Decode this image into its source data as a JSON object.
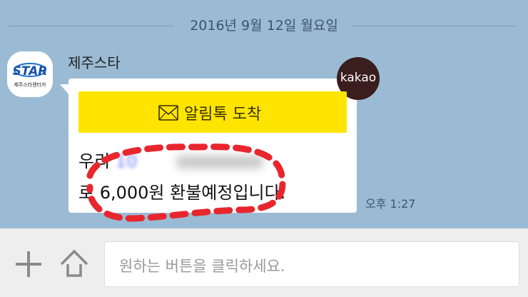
{
  "chat": {
    "date_separator": "2016년 9월 12일 월요일",
    "sender": {
      "name": "제주스타",
      "avatar_logo_text": "STAR",
      "avatar_subtext": "제주스타렌터카"
    },
    "badge": {
      "label": "kakao"
    },
    "message": {
      "notice_title": "알림톡 도착",
      "line1_visible": "우리 ",
      "line1_blurred": "10",
      "line2": "로 6,000원 환불예정입니다.",
      "time": "오후 1:27"
    }
  },
  "input_bar": {
    "placeholder": "원하는 버튼을 클릭하세요."
  },
  "colors": {
    "chat_background": "#9bbbd4",
    "notice_yellow": "#fee500",
    "kakao_brown": "#3a1d1d",
    "highlight_red": "#e8262e"
  },
  "icons": {
    "notice": "envelope-icon",
    "plus": "plus-icon",
    "up": "chevron-up-icon"
  }
}
